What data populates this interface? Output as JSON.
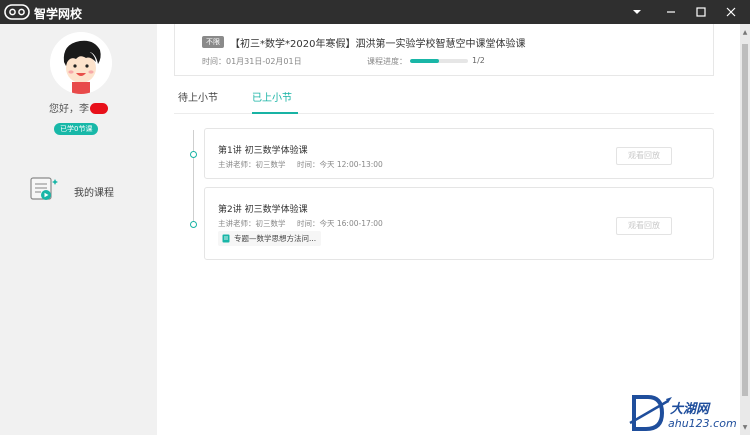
{
  "app": {
    "title": "智学网校",
    "window_controls": [
      "minimize-dropdown",
      "minimize",
      "maximize",
      "close"
    ]
  },
  "sidebar": {
    "greeting_prefix": "您好，",
    "user_name_prefix": "李",
    "learned_badge": "已学0节课",
    "nav": [
      {
        "label": "我的课程",
        "icon": "course-list-icon"
      }
    ]
  },
  "course": {
    "tag": "不限",
    "title": "【初三*数学*2020年寒假】泗洪第一实验学校智慧空中课堂体验课",
    "time": "时间：01月31日-02月01日",
    "progress_label": "课程进度：",
    "progress_fraction": 0.5,
    "progress_count": "1/2"
  },
  "tabs": [
    {
      "label": "待上小节",
      "active": false
    },
    {
      "label": "已上小节",
      "active": true
    }
  ],
  "lessons": [
    {
      "title": "第1讲 初三数学体验课",
      "teacher": "主讲老师：初三数学",
      "time": "时间：今天 12:00-13:00",
      "action": "观看回放"
    },
    {
      "title": "第2讲 初三数学体验课",
      "teacher": "主讲老师：初三数学",
      "time": "时间：今天 16:00-17:00",
      "action": "观看回放",
      "material": "专题—数学思想方法问..."
    }
  ],
  "colors": {
    "accent": "#18b3a4",
    "titlebar": "#2f2f2f"
  }
}
